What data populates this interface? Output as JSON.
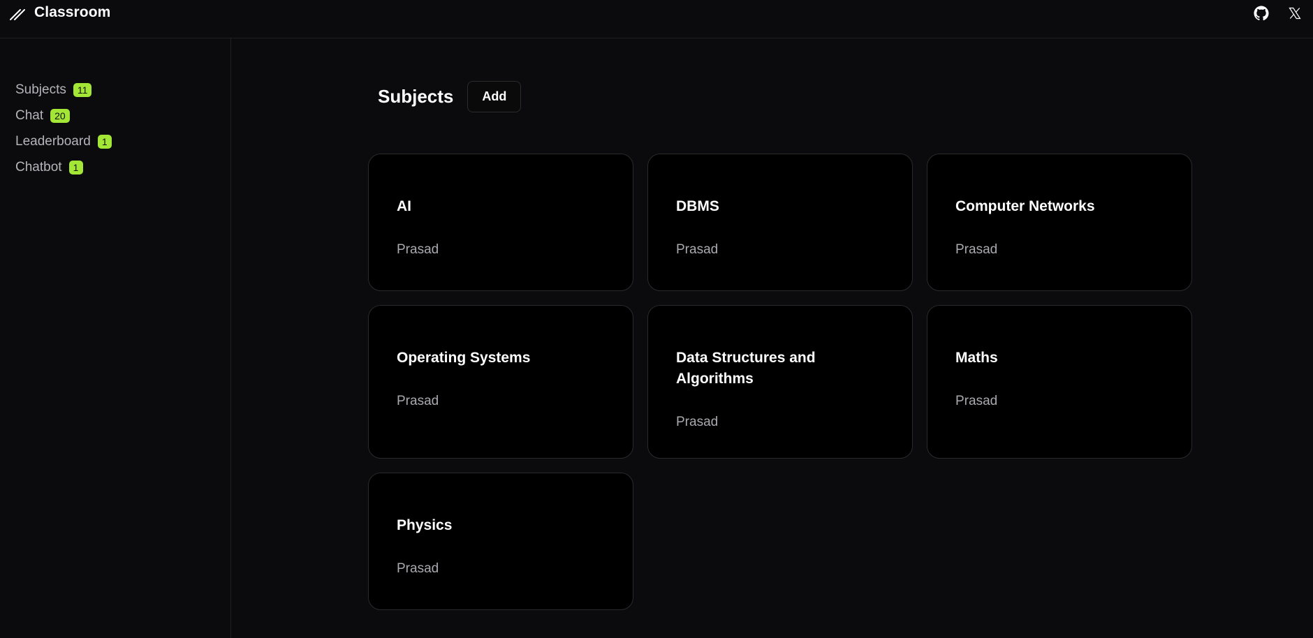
{
  "app": {
    "title": "Classroom"
  },
  "header_icons": [
    "github-icon",
    "x-twitter-icon"
  ],
  "sidebar": {
    "items": [
      {
        "label": "Subjects",
        "count": "11"
      },
      {
        "label": "Chat",
        "count": "20"
      },
      {
        "label": "Leaderboard",
        "count": "1"
      },
      {
        "label": "Chatbot",
        "count": "1"
      }
    ]
  },
  "main": {
    "title": "Subjects",
    "add_label": "Add",
    "subjects": [
      {
        "name": "AI",
        "teacher": "Prasad"
      },
      {
        "name": "DBMS",
        "teacher": "Prasad"
      },
      {
        "name": "Computer Networks",
        "teacher": "Prasad"
      },
      {
        "name": "Operating Systems",
        "teacher": "Prasad"
      },
      {
        "name": "Data Structures and Algorithms",
        "teacher": "Prasad"
      },
      {
        "name": "Maths",
        "teacher": "Prasad"
      },
      {
        "name": "Physics",
        "teacher": "Prasad"
      }
    ]
  },
  "colors": {
    "background": "#0b0b0d",
    "card": "#000000",
    "badge": "#a3e635",
    "muted_text": "#a9a9b0"
  }
}
